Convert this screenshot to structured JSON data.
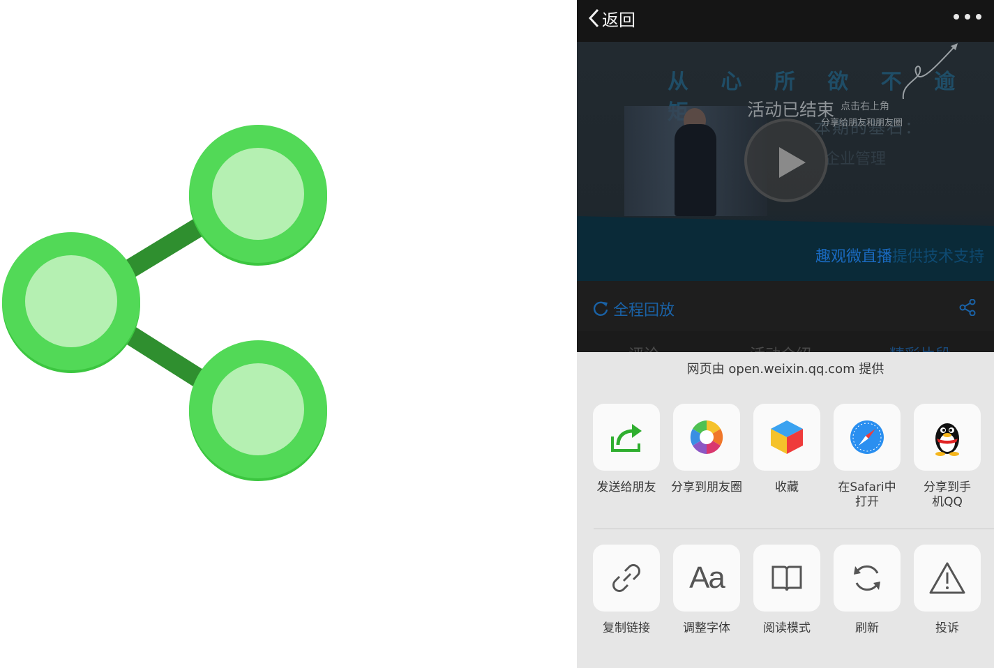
{
  "topbar": {
    "back_label": "返回"
  },
  "video": {
    "banner": "从 心 所 欲 不 逾 矩",
    "subtitle": "本期的基石：",
    "subtitle2": "企业管理",
    "ended": "活动已结束",
    "hint_line1": "点击右上角",
    "hint_line2": "分享给朋友和朋友圈",
    "tech_brand": "趣观微直播",
    "tech_rest": "提供技术支持"
  },
  "replay": {
    "label": "全程回放"
  },
  "tabs": [
    "评论",
    "活动介绍",
    "精彩片段"
  ],
  "sheet": {
    "provider": "网页由 open.weixin.qq.com 提供",
    "row1": [
      {
        "label": "发送给朋友",
        "icon": "send-to-friend-icon"
      },
      {
        "label": "分享到朋友圈",
        "icon": "moments-icon"
      },
      {
        "label": "收藏",
        "icon": "favorite-cube-icon"
      },
      {
        "label": "在Safari中打开",
        "icon": "safari-icon"
      },
      {
        "label": "分享到手机QQ",
        "icon": "qq-penguin-icon"
      }
    ],
    "row2": [
      {
        "label": "复制链接",
        "icon": "link-icon"
      },
      {
        "label": "调整字体",
        "icon": "font-size-icon"
      },
      {
        "label": "阅读模式",
        "icon": "book-icon"
      },
      {
        "label": "刷新",
        "icon": "refresh-icon"
      },
      {
        "label": "投诉",
        "icon": "warning-icon"
      }
    ]
  },
  "colors": {
    "share_green": "#43d24a",
    "share_green_light": "#b5f0b2",
    "share_line": "#2f8f2f",
    "replay_blue": "#1a62a6",
    "sheet_bg": "#e6e6e6"
  }
}
